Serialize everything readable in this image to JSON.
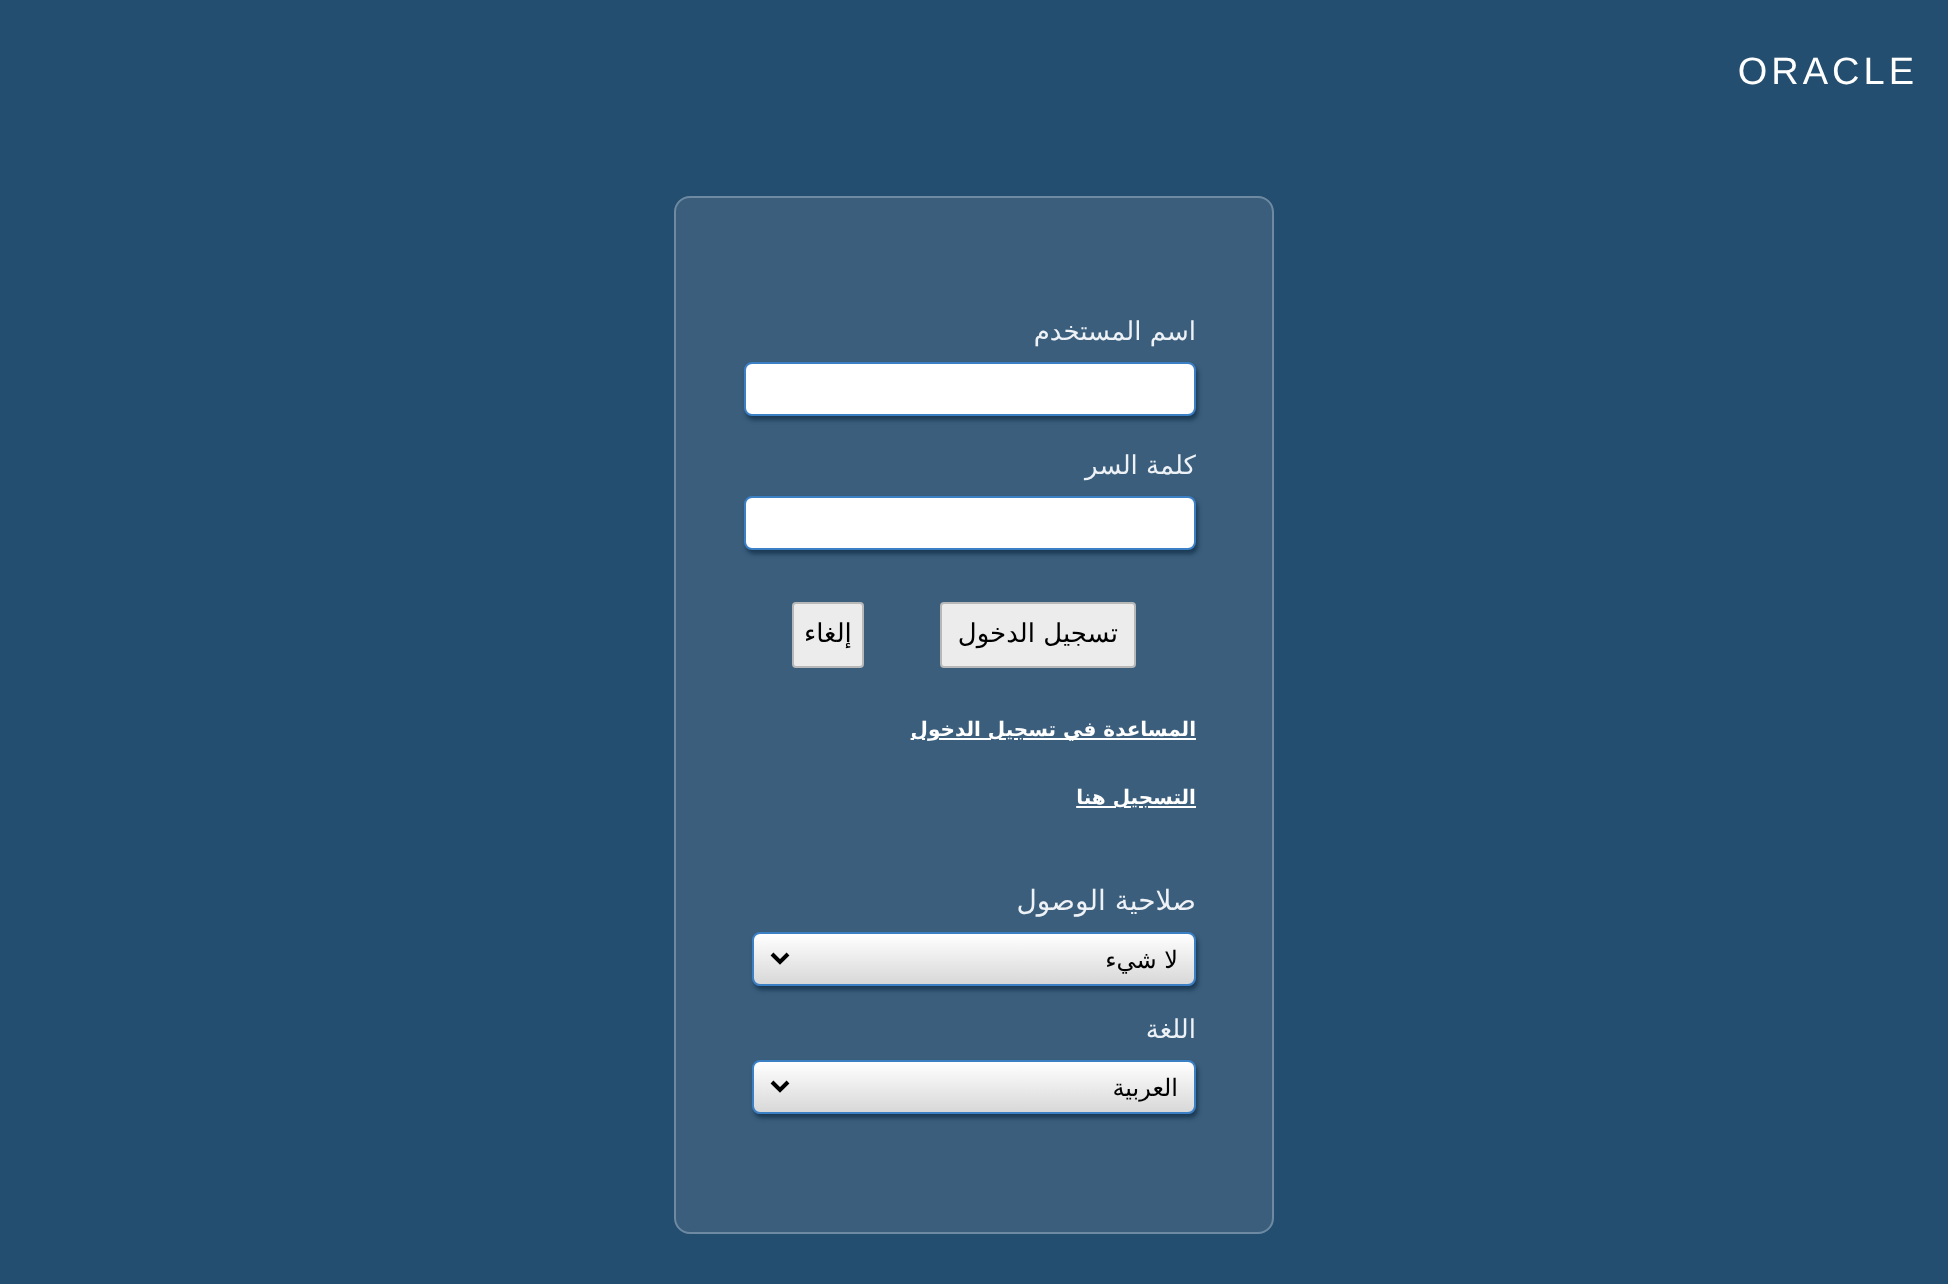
{
  "logo": {
    "text": "ORACLE"
  },
  "form": {
    "username": {
      "label": "اسم المستخدم"
    },
    "password": {
      "label": "كلمة السر"
    },
    "buttons": [
      {
        "kind": "login",
        "label": "تسجيل الدخول"
      },
      {
        "kind": "cancel",
        "label": "إلغاء"
      }
    ],
    "links": [
      "المساعدة في تسجيل الدخول",
      "التسجيل هنا"
    ],
    "access": {
      "label": "صلاحية الوصول",
      "value": "لا شيء"
    },
    "language": {
      "label": "اللغة",
      "value": "العربية"
    }
  }
}
